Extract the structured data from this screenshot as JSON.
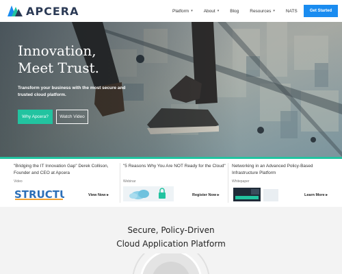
{
  "brand": {
    "name": "APCERA",
    "accent": "#1a8cf0",
    "teal": "#22c3a0"
  },
  "nav": {
    "items": [
      {
        "label": "Platform",
        "has_dropdown": true
      },
      {
        "label": "About",
        "has_dropdown": true
      },
      {
        "label": "Blog",
        "has_dropdown": false
      },
      {
        "label": "Resources",
        "has_dropdown": true
      },
      {
        "label": "NATS",
        "has_dropdown": false
      }
    ],
    "cta_label": "Get Started",
    "chevron": "▾"
  },
  "hero": {
    "title_line1": "Innovation,",
    "title_line2": "Meet Trust.",
    "subtitle": "Transform your business with the most secure and trusted cloud platform.",
    "primary_button": "Why Apcera?",
    "secondary_button": "Watch Video"
  },
  "cards": [
    {
      "title": "\"Bridging the IT Innovation Gap\" Derek Collison, Founder and CEO at Apcera",
      "type": "Video",
      "image_text": "STRUCTURE",
      "link_label": "View Now"
    },
    {
      "title": "\"5 Reasons Why You Are NOT Ready for the Cloud\"",
      "type": "Webinar",
      "link_label": "Register Now"
    },
    {
      "title": "Networking in an Advanced Policy-Based Infrastructure Platform",
      "type": "Whitepaper",
      "link_label": "Learn More"
    }
  ],
  "link_arrow": "▸",
  "section": {
    "title_line1": "Secure, Policy-Driven",
    "title_line2": "Cloud Application Platform"
  }
}
